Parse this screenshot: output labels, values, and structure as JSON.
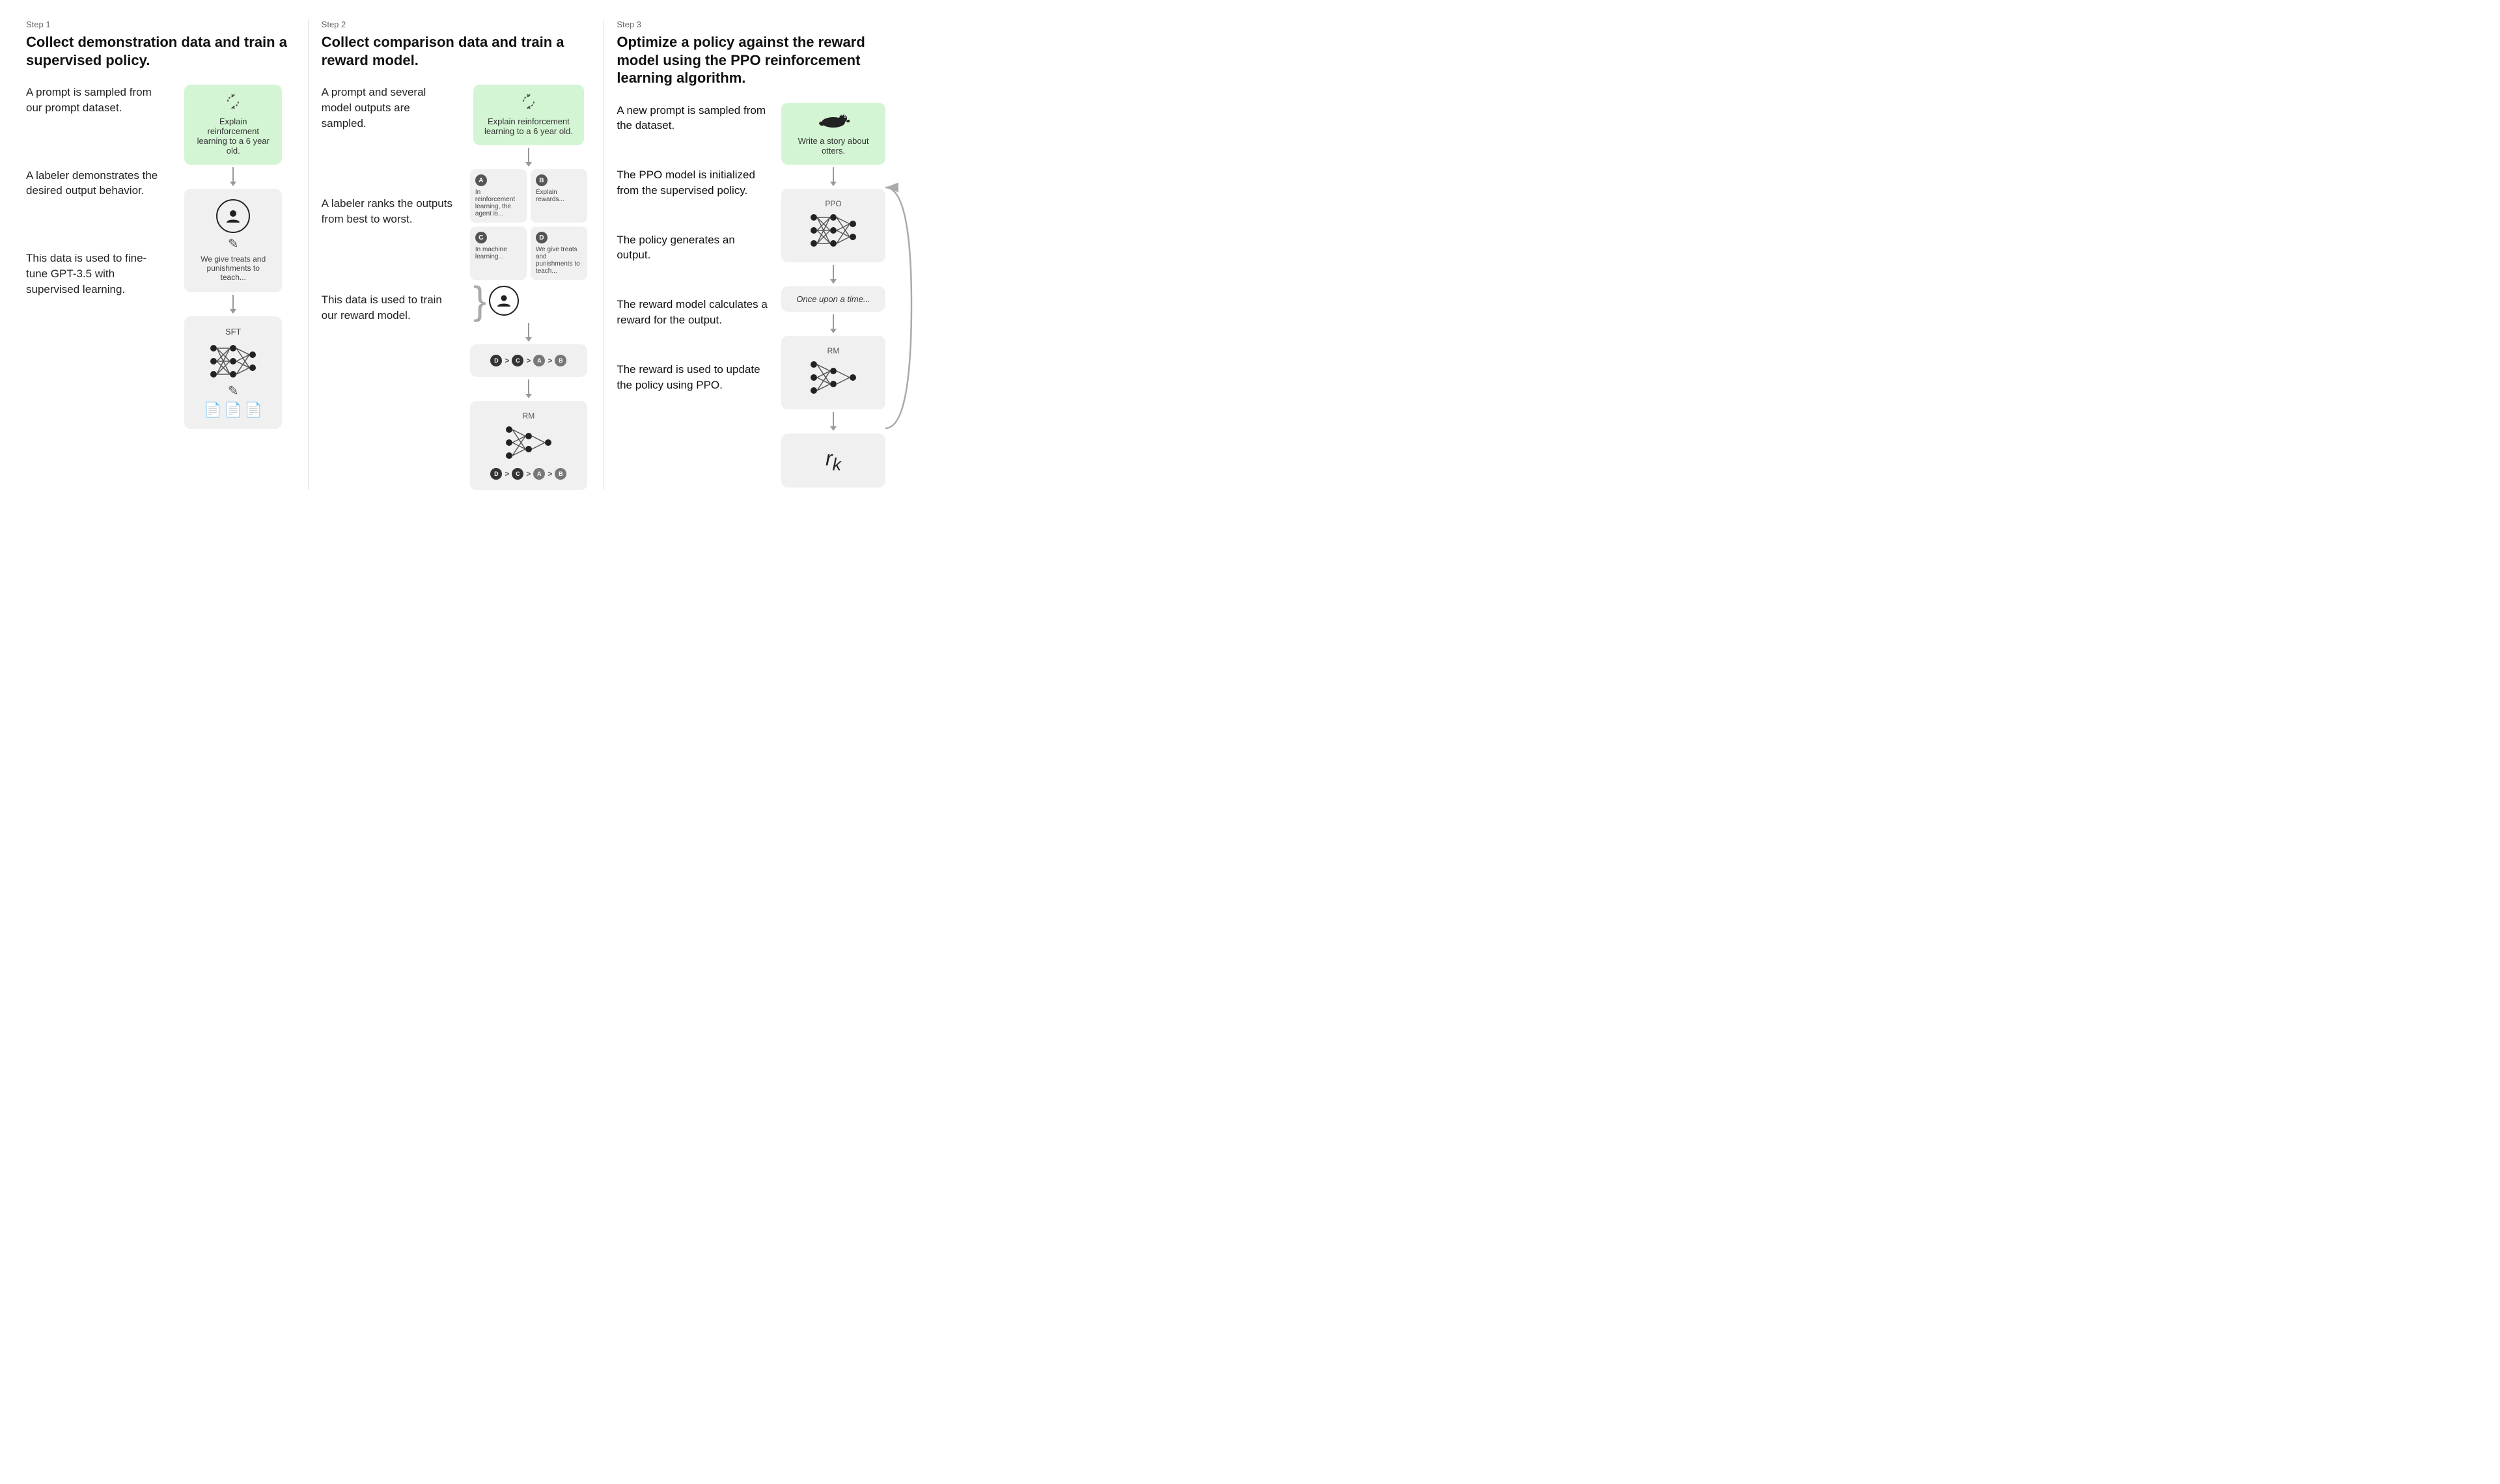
{
  "steps": [
    {
      "label": "Step 1",
      "title": "Collect demonstration data and train a supervised policy.",
      "left_texts": [
        "A prompt is sampled from our prompt dataset.",
        "A labeler demonstrates the desired output behavior.",
        "This data is used to fine-tune GPT-3.5 with supervised learning."
      ],
      "prompt_box_text": "Explain reinforcement learning to a 6 year old.",
      "labeler_caption": "We give treats and punishments to teach...",
      "model_label": "SFT"
    },
    {
      "label": "Step 2",
      "title": "Collect comparison data and train a reward model.",
      "left_texts": [
        "A prompt and several model outputs are sampled.",
        "A labeler ranks the outputs from best to worst.",
        "This data is used to train our reward model."
      ],
      "prompt_box_text": "Explain reinforcement learning to a 6 year old.",
      "outputs": [
        {
          "letter": "A",
          "text": "In reinforcement learning, the agent is..."
        },
        {
          "letter": "B",
          "text": "Explain rewards..."
        },
        {
          "letter": "C",
          "text": "In machine learning..."
        },
        {
          "letter": "D",
          "text": "We give treats and punishments to teach..."
        }
      ],
      "ranking": [
        "D",
        "C",
        "A",
        "B"
      ],
      "model_label": "RM"
    },
    {
      "label": "Step 3",
      "title": "Optimize a policy against the reward model using the PPO reinforcement learning algorithm.",
      "left_texts": [
        "A new prompt is sampled from the dataset.",
        "The PPO model is initialized from the supervised policy.",
        "The policy generates an output.",
        "The reward model calculates a reward for the output.",
        "The reward is used to update the policy using PPO."
      ],
      "prompt_box_text": "Write a story about otters.",
      "ppo_label": "PPO",
      "output_text": "Once upon a time...",
      "rm_label": "RM",
      "rk_text": "r_k"
    }
  ],
  "icons": {
    "recycle": "↻",
    "person": "👤",
    "pencil": "✎",
    "doc": "📄"
  }
}
